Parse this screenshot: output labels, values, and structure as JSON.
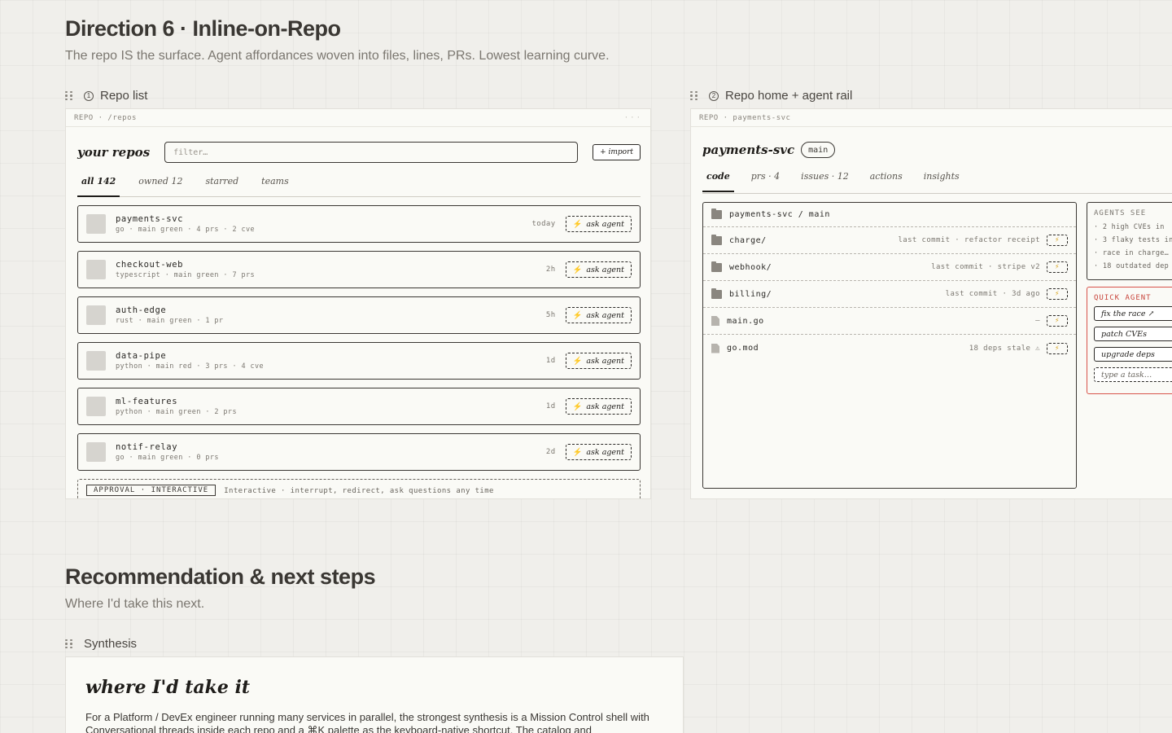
{
  "direction": {
    "title": "Direction 6 · Inline-on-Repo",
    "subtitle": "The repo IS the surface. Agent affordances woven into files, lines, PRs. Lowest learning curve."
  },
  "frame1": {
    "number": "1",
    "label": "Repo list",
    "breadcrumb": "REPO · /repos",
    "title": "your repos",
    "filter_placeholder": "filter…",
    "import_label": "+ import",
    "tabs": [
      "all 142",
      "owned 12",
      "starred",
      "teams"
    ],
    "ask_label": "ask agent",
    "repos": [
      {
        "name": "payments-svc",
        "meta": "go · main green · 4 prs · 2 cve",
        "time": "today"
      },
      {
        "name": "checkout-web",
        "meta": "typescript · main green · 7 prs",
        "time": "2h"
      },
      {
        "name": "auth-edge",
        "meta": "rust · main green · 1 pr",
        "time": "5h"
      },
      {
        "name": "data-pipe",
        "meta": "python · main red · 3 prs · 4 cve",
        "time": "1d"
      },
      {
        "name": "ml-features",
        "meta": "python · main green · 2 prs",
        "time": "1d"
      },
      {
        "name": "notif-relay",
        "meta": "go · main green · 0 prs",
        "time": "2d"
      }
    ],
    "approval_badge": "APPROVAL · INTERACTIVE",
    "approval_text": "Interactive · interrupt, redirect, ask questions any time"
  },
  "frame2": {
    "number": "2",
    "label": "Repo home + agent rail",
    "breadcrumb": "REPO · payments-svc",
    "title": "payments-svc",
    "branch": "main",
    "tabs": [
      "code",
      "prs · 4",
      "issues · 12",
      "actions",
      "insights"
    ],
    "path": "payments-svc / main",
    "files": [
      {
        "name": "charge/",
        "type": "folder",
        "commit": "last commit · refactor receipt"
      },
      {
        "name": "webhook/",
        "type": "folder",
        "commit": "last commit · stripe v2"
      },
      {
        "name": "billing/",
        "type": "folder",
        "commit": "last commit · 3d ago"
      },
      {
        "name": "main.go",
        "type": "file",
        "commit": "–"
      },
      {
        "name": "go.mod",
        "type": "file",
        "commit": "18 deps stale ⚠"
      }
    ],
    "agents_see_title": "AGENTS SEE",
    "agents_see": [
      "· 2 high CVEs in",
      "· 3 flaky tests in",
      "· race in charge…",
      "· 18 outdated dep"
    ],
    "quick_agent_title": "QUICK AGENT",
    "quick_actions": [
      "fix the race ↗",
      "patch CVEs",
      "upgrade deps"
    ],
    "quick_input": "type a task…"
  },
  "recommendation": {
    "title": "Recommendation & next steps",
    "subtitle": "Where I'd take this next.",
    "frame_label": "Synthesis",
    "card_title": "where I'd take it",
    "card_text": "For a Platform / DevEx engineer running many services in parallel, the strongest synthesis is a Mission Control shell with Conversational threads inside each repo and a ⌘K palette as the keyboard-native shortcut. The catalog and"
  }
}
